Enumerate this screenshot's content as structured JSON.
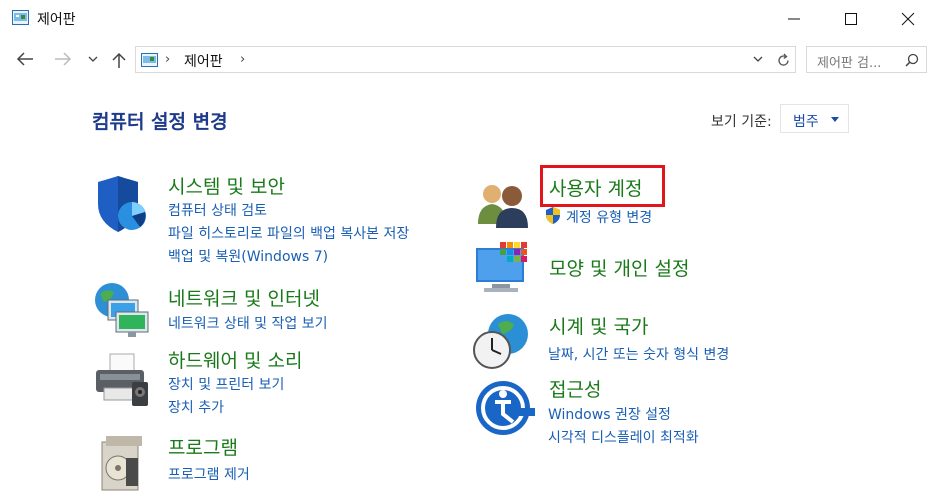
{
  "window": {
    "title": "제어판"
  },
  "navigation": {
    "breadcrumb": "제어판",
    "search_placeholder": "제어판 검..."
  },
  "main": {
    "page_title": "컴퓨터 설정 변경",
    "view_by_label": "보기 기준:",
    "view_by_value": "범주"
  },
  "categories": [
    {
      "title": "시스템 및 보안",
      "icon": "shield-icon",
      "links": [
        "컴퓨터 상태 검토",
        "파일 히스토리로 파일의 백업 복사본 저장",
        "백업 및 복원(Windows 7)"
      ]
    },
    {
      "title": "네트워크 및 인터넷",
      "icon": "network-icon",
      "links": [
        "네트워크 상태 및 작업 보기"
      ]
    },
    {
      "title": "하드웨어 및 소리",
      "icon": "printer-icon",
      "links": [
        "장치 및 프린터 보기",
        "장치 추가"
      ]
    },
    {
      "title": "프로그램",
      "icon": "programs-icon",
      "links": [
        "프로그램 제거"
      ]
    },
    {
      "title": "사용자 계정",
      "icon": "users-icon",
      "links": [
        "계정 유형 변경"
      ]
    },
    {
      "title": "모양 및 개인 설정",
      "icon": "monitor-icon",
      "links": []
    },
    {
      "title": "시계 및 국가",
      "icon": "clock-globe-icon",
      "links": [
        "날짜, 시간 또는 숫자 형식 변경"
      ]
    },
    {
      "title": "접근성",
      "icon": "accessibility-icon",
      "links": [
        "Windows 권장 설정",
        "시각적 디스플레이 최적화"
      ]
    }
  ],
  "colors": {
    "category_title": "#1a7a1a",
    "link": "#1a5fb4",
    "highlight": "#e2151c"
  }
}
